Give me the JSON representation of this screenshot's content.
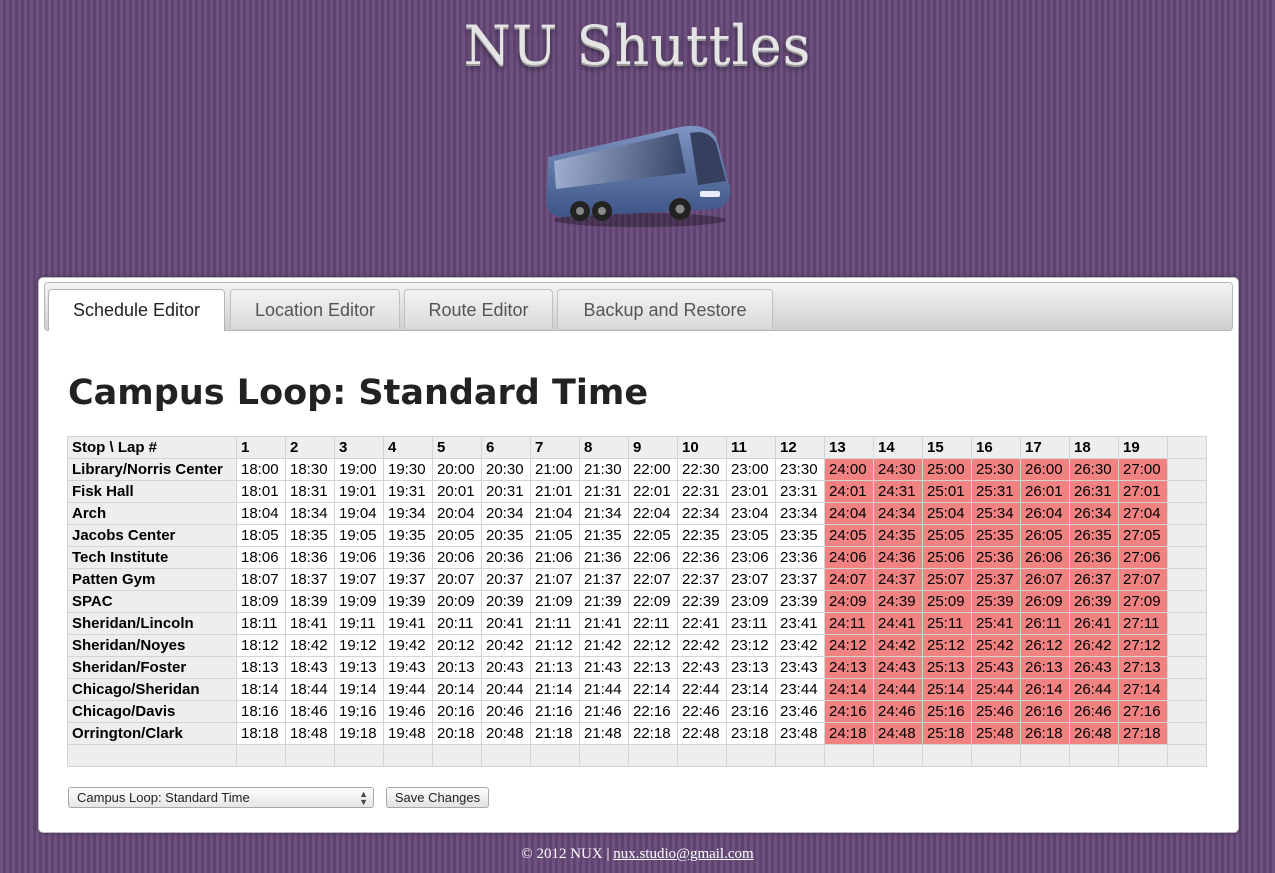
{
  "header": {
    "title": "NU Shuttles"
  },
  "tabs": [
    "Schedule Editor",
    "Location Editor",
    "Route Editor",
    "Backup and Restore"
  ],
  "schedule": {
    "heading": "Campus Loop: Standard Time",
    "corner_header": "Stop \\ Lap #",
    "laps": [
      "1",
      "2",
      "3",
      "4",
      "5",
      "6",
      "7",
      "8",
      "9",
      "10",
      "11",
      "12",
      "13",
      "14",
      "15",
      "16",
      "17",
      "18",
      "19"
    ],
    "late_start_index": 12,
    "late_color": "#f08282",
    "rows": [
      {
        "stop": "Library/Norris Center",
        "times": [
          "18:00",
          "18:30",
          "19:00",
          "19:30",
          "20:00",
          "20:30",
          "21:00",
          "21:30",
          "22:00",
          "22:30",
          "23:00",
          "23:30",
          "24:00",
          "24:30",
          "25:00",
          "25:30",
          "26:00",
          "26:30",
          "27:00"
        ]
      },
      {
        "stop": "Fisk Hall",
        "times": [
          "18:01",
          "18:31",
          "19:01",
          "19:31",
          "20:01",
          "20:31",
          "21:01",
          "21:31",
          "22:01",
          "22:31",
          "23:01",
          "23:31",
          "24:01",
          "24:31",
          "25:01",
          "25:31",
          "26:01",
          "26:31",
          "27:01"
        ]
      },
      {
        "stop": "Arch",
        "times": [
          "18:04",
          "18:34",
          "19:04",
          "19:34",
          "20:04",
          "20:34",
          "21:04",
          "21:34",
          "22:04",
          "22:34",
          "23:04",
          "23:34",
          "24:04",
          "24:34",
          "25:04",
          "25:34",
          "26:04",
          "26:34",
          "27:04"
        ]
      },
      {
        "stop": "Jacobs Center",
        "times": [
          "18:05",
          "18:35",
          "19:05",
          "19:35",
          "20:05",
          "20:35",
          "21:05",
          "21:35",
          "22:05",
          "22:35",
          "23:05",
          "23:35",
          "24:05",
          "24:35",
          "25:05",
          "25:35",
          "26:05",
          "26:35",
          "27:05"
        ]
      },
      {
        "stop": "Tech Institute",
        "times": [
          "18:06",
          "18:36",
          "19:06",
          "19:36",
          "20:06",
          "20:36",
          "21:06",
          "21:36",
          "22:06",
          "22:36",
          "23:06",
          "23:36",
          "24:06",
          "24:36",
          "25:06",
          "25:36",
          "26:06",
          "26:36",
          "27:06"
        ]
      },
      {
        "stop": "Patten Gym",
        "times": [
          "18:07",
          "18:37",
          "19:07",
          "19:37",
          "20:07",
          "20:37",
          "21:07",
          "21:37",
          "22:07",
          "22:37",
          "23:07",
          "23:37",
          "24:07",
          "24:37",
          "25:07",
          "25:37",
          "26:07",
          "26:37",
          "27:07"
        ]
      },
      {
        "stop": "SPAC",
        "times": [
          "18:09",
          "18:39",
          "19:09",
          "19:39",
          "20:09",
          "20:39",
          "21:09",
          "21:39",
          "22:09",
          "22:39",
          "23:09",
          "23:39",
          "24:09",
          "24:39",
          "25:09",
          "25:39",
          "26:09",
          "26:39",
          "27:09"
        ]
      },
      {
        "stop": "Sheridan/Lincoln",
        "times": [
          "18:11",
          "18:41",
          "19:11",
          "19:41",
          "20:11",
          "20:41",
          "21:11",
          "21:41",
          "22:11",
          "22:41",
          "23:11",
          "23:41",
          "24:11",
          "24:41",
          "25:11",
          "25:41",
          "26:11",
          "26:41",
          "27:11"
        ]
      },
      {
        "stop": "Sheridan/Noyes",
        "times": [
          "18:12",
          "18:42",
          "19:12",
          "19:42",
          "20:12",
          "20:42",
          "21:12",
          "21:42",
          "22:12",
          "22:42",
          "23:12",
          "23:42",
          "24:12",
          "24:42",
          "25:12",
          "25:42",
          "26:12",
          "26:42",
          "27:12"
        ]
      },
      {
        "stop": "Sheridan/Foster",
        "times": [
          "18:13",
          "18:43",
          "19:13",
          "19:43",
          "20:13",
          "20:43",
          "21:13",
          "21:43",
          "22:13",
          "22:43",
          "23:13",
          "23:43",
          "24:13",
          "24:43",
          "25:13",
          "25:43",
          "26:13",
          "26:43",
          "27:13"
        ]
      },
      {
        "stop": "Chicago/Sheridan",
        "times": [
          "18:14",
          "18:44",
          "19:14",
          "19:44",
          "20:14",
          "20:44",
          "21:14",
          "21:44",
          "22:14",
          "22:44",
          "23:14",
          "23:44",
          "24:14",
          "24:44",
          "25:14",
          "25:44",
          "26:14",
          "26:44",
          "27:14"
        ]
      },
      {
        "stop": "Chicago/Davis",
        "times": [
          "18:16",
          "18:46",
          "19:16",
          "19:46",
          "20:16",
          "20:46",
          "21:16",
          "21:46",
          "22:16",
          "22:46",
          "23:16",
          "23:46",
          "24:16",
          "24:46",
          "25:16",
          "25:46",
          "26:16",
          "26:46",
          "27:16"
        ]
      },
      {
        "stop": "Orrington/Clark",
        "times": [
          "18:18",
          "18:48",
          "19:18",
          "19:48",
          "20:18",
          "20:48",
          "21:18",
          "21:48",
          "22:18",
          "22:48",
          "23:18",
          "23:48",
          "24:18",
          "24:48",
          "25:18",
          "25:48",
          "26:18",
          "26:48",
          "27:18"
        ]
      }
    ]
  },
  "controls": {
    "schedule_select_value": "Campus Loop: Standard Time",
    "save_label": "Save Changes"
  },
  "footer": {
    "text": "© 2012 NUX | ",
    "email": "nux.studio@gmail.com"
  }
}
